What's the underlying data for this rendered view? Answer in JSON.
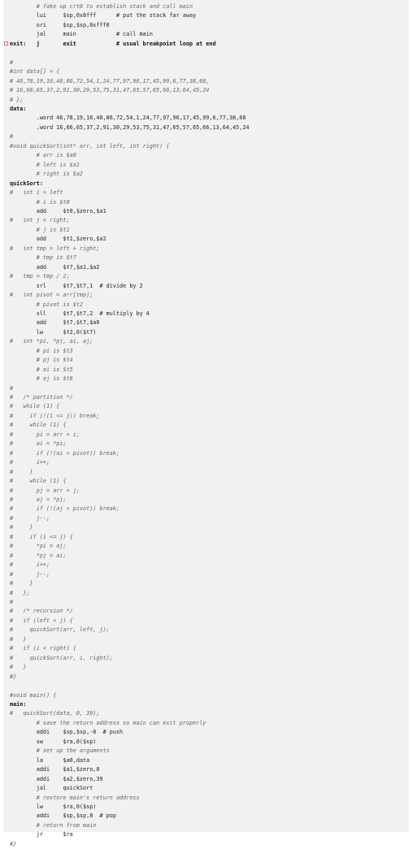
{
  "editor": {
    "breakpoint_color": "#e26a6a",
    "lines": [
      {
        "t": "        # fake up crt0 to establish stack and call main",
        "cls": "c"
      },
      {
        "t": "        lui     $sp,0x8fff      # put the stack far away",
        "cls": "k"
      },
      {
        "t": "        ori     $sp,$sp,0xfff0",
        "cls": "k"
      },
      {
        "t": "        jal     main            # call main",
        "cls": "k"
      },
      {
        "t": "exit:   j       exit            # usual breakpoint loop at end",
        "cls": "lbl",
        "bp": true
      },
      {
        "t": "",
        "cls": "k"
      },
      {
        "t": "#",
        "cls": "c"
      },
      {
        "t": "#int data[] = {",
        "cls": "c"
      },
      {
        "t": "# 46,78,19,16,40,86,72,54,1,24,77,97,96,17,45,99,6,77,38,60,",
        "cls": "c"
      },
      {
        "t": "# 16,66,65,37,2,91,30,29,53,75,31,47,65,57,65,66,13,64,45,24",
        "cls": "c"
      },
      {
        "t": "# };",
        "cls": "c"
      },
      {
        "t": "data:",
        "cls": "lbl"
      },
      {
        "t": "        .word 46,78,19,16,40,86,72,54,1,24,77,97,96,17,45,99,6,77,38,60",
        "cls": "k"
      },
      {
        "t": "        .word 16,66,65,37,2,91,30,29,53,75,31,47,65,57,65,66,13,64,45,24",
        "cls": "k"
      },
      {
        "t": "#",
        "cls": "c"
      },
      {
        "t": "#void quickSort(int* arr, int left, int right) {",
        "cls": "c"
      },
      {
        "t": "        # arr is $a0",
        "cls": "c"
      },
      {
        "t": "        # left is $a1",
        "cls": "c"
      },
      {
        "t": "        # right is $a2",
        "cls": "c"
      },
      {
        "t": "quickSort:",
        "cls": "lbl"
      },
      {
        "t": "#   int i = left",
        "cls": "c"
      },
      {
        "t": "        # i is $t0",
        "cls": "c"
      },
      {
        "t": "        add     $t0,$zero,$a1",
        "cls": "k"
      },
      {
        "t": "#   int j = right;",
        "cls": "c"
      },
      {
        "t": "        # j is $t1",
        "cls": "c"
      },
      {
        "t": "        add     $t1,$zero,$a2",
        "cls": "k"
      },
      {
        "t": "#   int tmp = left + right;",
        "cls": "c"
      },
      {
        "t": "        # tmp is $t7",
        "cls": "c"
      },
      {
        "t": "        add     $t7,$a1,$a2",
        "cls": "k"
      },
      {
        "t": "#   tmp = tmp / 2;",
        "cls": "c"
      },
      {
        "t": "        srl     $t7,$t7,1  # divide by 2",
        "cls": "k"
      },
      {
        "t": "#   int pivot = arr[tmp];",
        "cls": "c"
      },
      {
        "t": "        # pivot is $t2",
        "cls": "c"
      },
      {
        "t": "        sll     $t7,$t7,2  # multiply by 4",
        "cls": "k"
      },
      {
        "t": "        add     $t7,$t7,$a0",
        "cls": "k"
      },
      {
        "t": "        lw      $t2,0($t7)",
        "cls": "k"
      },
      {
        "t": "#   int *pi, *pj, ai, aj;",
        "cls": "c"
      },
      {
        "t": "        # pi is $t3",
        "cls": "c"
      },
      {
        "t": "        # pj is $t4",
        "cls": "c"
      },
      {
        "t": "        # ai is $t5",
        "cls": "c"
      },
      {
        "t": "        # aj is $t6",
        "cls": "c"
      },
      {
        "t": "#",
        "cls": "c"
      },
      {
        "t": "#   /* partition */",
        "cls": "c"
      },
      {
        "t": "#   while (1) {",
        "cls": "c"
      },
      {
        "t": "#     if (!(i <= j)) break;",
        "cls": "c"
      },
      {
        "t": "#     while (1) {",
        "cls": "c"
      },
      {
        "t": "#       pi = arr + i;",
        "cls": "c"
      },
      {
        "t": "#       ai = *pi;",
        "cls": "c"
      },
      {
        "t": "#       if (!(ai < pivot)) break;",
        "cls": "c"
      },
      {
        "t": "#       i++;",
        "cls": "c"
      },
      {
        "t": "#     }",
        "cls": "c"
      },
      {
        "t": "#     while (1) {",
        "cls": "c"
      },
      {
        "t": "#       pj = arr + j;",
        "cls": "c"
      },
      {
        "t": "#       aj = *pj;",
        "cls": "c"
      },
      {
        "t": "#       if (!(aj > pivot)) break;",
        "cls": "c"
      },
      {
        "t": "#       j--;",
        "cls": "c"
      },
      {
        "t": "#     }",
        "cls": "c"
      },
      {
        "t": "#     if (i <= j) {",
        "cls": "c"
      },
      {
        "t": "#       *pi = aj;",
        "cls": "c"
      },
      {
        "t": "#       *pj = ai;",
        "cls": "c"
      },
      {
        "t": "#       i++;",
        "cls": "c"
      },
      {
        "t": "#       j--;",
        "cls": "c"
      },
      {
        "t": "#     }",
        "cls": "c"
      },
      {
        "t": "#   };",
        "cls": "c"
      },
      {
        "t": "#",
        "cls": "c"
      },
      {
        "t": "#   /* recursion */",
        "cls": "c"
      },
      {
        "t": "#   if (left < j) {",
        "cls": "c"
      },
      {
        "t": "#     quickSort(arr, left, j);",
        "cls": "c"
      },
      {
        "t": "#   }",
        "cls": "c"
      },
      {
        "t": "#   if (i < right) {",
        "cls": "c"
      },
      {
        "t": "#     quickSort(arr, i, right);",
        "cls": "c"
      },
      {
        "t": "#   }",
        "cls": "c"
      },
      {
        "t": "#}",
        "cls": "c"
      },
      {
        "t": "",
        "cls": "k"
      },
      {
        "t": "#void main() {",
        "cls": "c"
      },
      {
        "t": "main:",
        "cls": "lbl"
      },
      {
        "t": "#   quickSort(data, 0, 39);",
        "cls": "c"
      },
      {
        "t": "        # save the return address so main can exit properly",
        "cls": "c"
      },
      {
        "t": "        addi    $sp,$sp,-8  # push",
        "cls": "k"
      },
      {
        "t": "        sw      $ra,0($sp)",
        "cls": "k"
      },
      {
        "t": "        # set up the arguments",
        "cls": "c"
      },
      {
        "t": "        la      $a0,data",
        "cls": "k"
      },
      {
        "t": "        addi    $a1,$zero,0",
        "cls": "k"
      },
      {
        "t": "        addi    $a2,$zero,39",
        "cls": "k"
      },
      {
        "t": "        jal     quickSort",
        "cls": "k"
      },
      {
        "t": "        # restore main's return address",
        "cls": "c"
      },
      {
        "t": "        lw      $ra,0($sp)",
        "cls": "k"
      },
      {
        "t": "        addi    $sp,$sp,8  # pop",
        "cls": "k"
      },
      {
        "t": "        # return from main",
        "cls": "c"
      },
      {
        "t": "        jr      $ra",
        "cls": "k"
      },
      {
        "t": "#}",
        "cls": "c"
      }
    ]
  }
}
